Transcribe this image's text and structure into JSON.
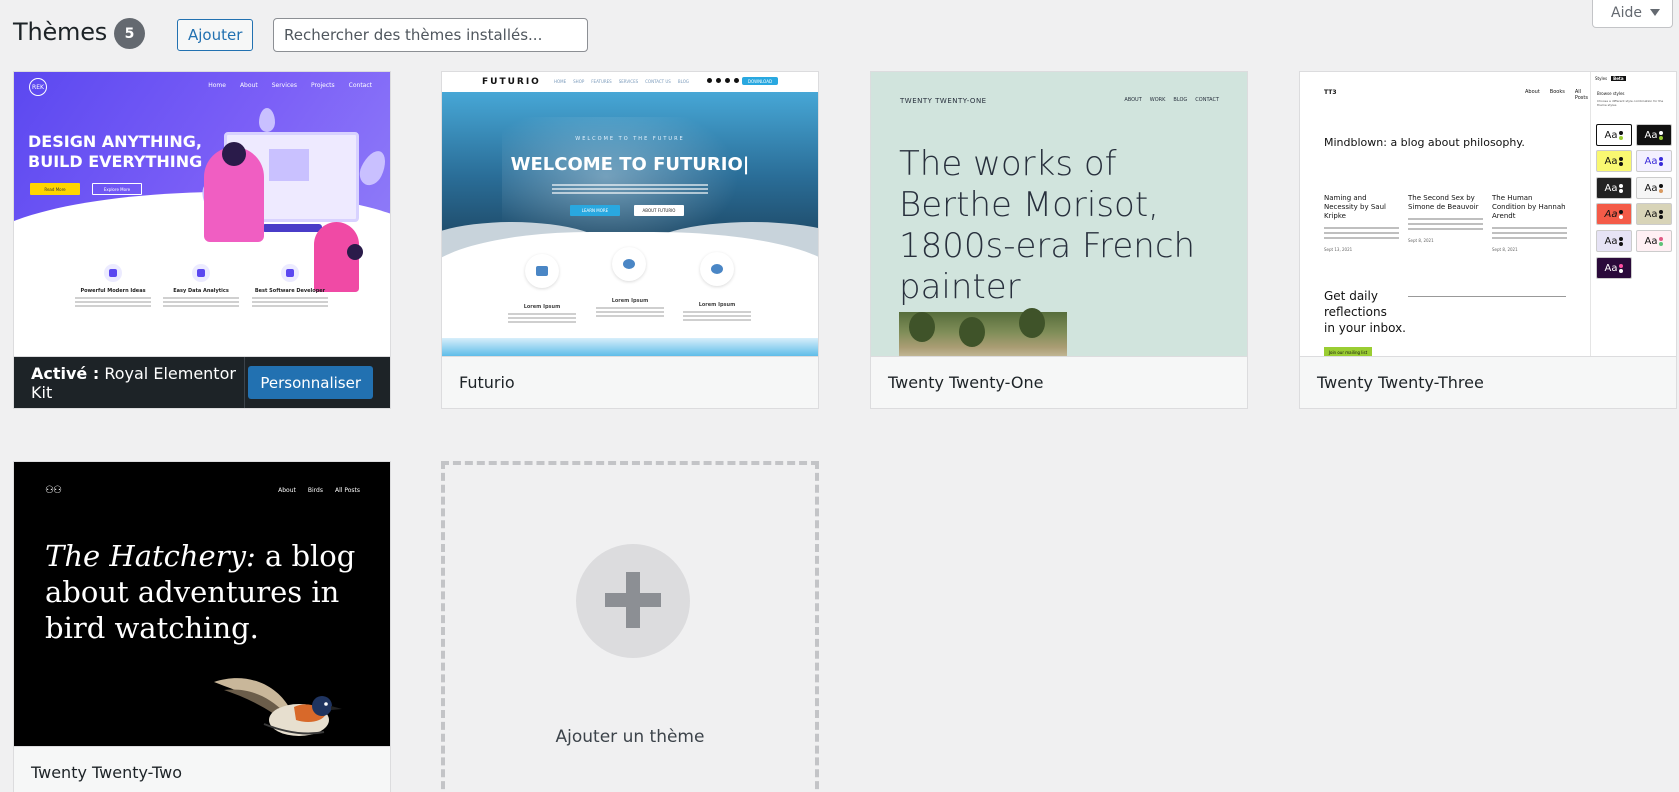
{
  "header": {
    "title": "Thèmes",
    "count": "5",
    "add_button": "Ajouter",
    "search_placeholder": "Rechercher des thèmes installés...",
    "help": "Aide"
  },
  "themes": [
    {
      "name": "Royal Elementor Kit",
      "active_prefix": "Activé :",
      "customize_button": "Personnaliser",
      "preview": {
        "nav": [
          "Home",
          "About",
          "Services",
          "Projects",
          "Contact"
        ],
        "headline_1": "DESIGN ANYTHING,",
        "headline_2": "BUILD EVERYTHING",
        "btn_primary": "Read More",
        "btn_secondary": "Explore More",
        "features": [
          "Powerful Modern Ideas",
          "Easy Data Analytics",
          "Best Software Developer"
        ]
      }
    },
    {
      "name": "Futurio",
      "preview": {
        "logo": "FUTURIO",
        "menu": [
          "HOME",
          "SHOP",
          "FEATURES",
          "SERVICES",
          "CONTACT US",
          "BLOG"
        ],
        "download": "DOWNLOAD",
        "welcome": "WELCOME TO THE FUTURE",
        "headline": "WELCOME TO FUTURIO|",
        "btn_learn": "LEARN MORE",
        "btn_about": "ABOUT FUTURIO",
        "columns": [
          "Lorem Ipsum",
          "Lorem Ipsum",
          "Lorem Ipsum"
        ]
      }
    },
    {
      "name": "Twenty Twenty-One",
      "preview": {
        "brand": "TWENTY TWENTY-ONE",
        "nav": [
          "ABOUT",
          "WORK",
          "BLOG",
          "CONTACT"
        ],
        "headline": "The works of Berthe Morisot, 1800s-era French painter"
      }
    },
    {
      "name": "Twenty Twenty-Three",
      "preview": {
        "brand": "TT3",
        "nav": [
          "About",
          "Books",
          "All Posts"
        ],
        "headline": "Mindblown: a blog about philosophy.",
        "posts": [
          {
            "title": "Naming and Necessity by Saul Kripke",
            "date": "Sept 13, 2021"
          },
          {
            "title": "The Second Sex by Simone de Beauvoir",
            "date": "Sept 8, 2021"
          },
          {
            "title": "The Human Condition by Hannah Arendt",
            "date": "Sept 8, 2021"
          }
        ],
        "newsletter_line1": "Get daily",
        "newsletter_line2": "reflections",
        "newsletter_line3": "in your inbox.",
        "join_button": "Join our mailing list",
        "panel_tab1": "Styles",
        "panel_tab2": "Beta",
        "panel_title": "Browse styles",
        "panel_desc": "Choose a different style combination for the theme styles",
        "swatch_label": "Aa"
      }
    },
    {
      "name": "Twenty Twenty-Two",
      "preview": {
        "logo": "⚇⚇",
        "nav": [
          "About",
          "Birds",
          "All Posts"
        ],
        "headline_italic": "The Hatchery:",
        "headline_rest": " a blog about adventures in bird watching."
      }
    }
  ],
  "add_theme": {
    "label": "Ajouter un thème"
  },
  "colors": {
    "background": "#f0f0f1",
    "accent": "#2271b1",
    "active_bar": "#1d2327",
    "count_badge": "#646970"
  }
}
